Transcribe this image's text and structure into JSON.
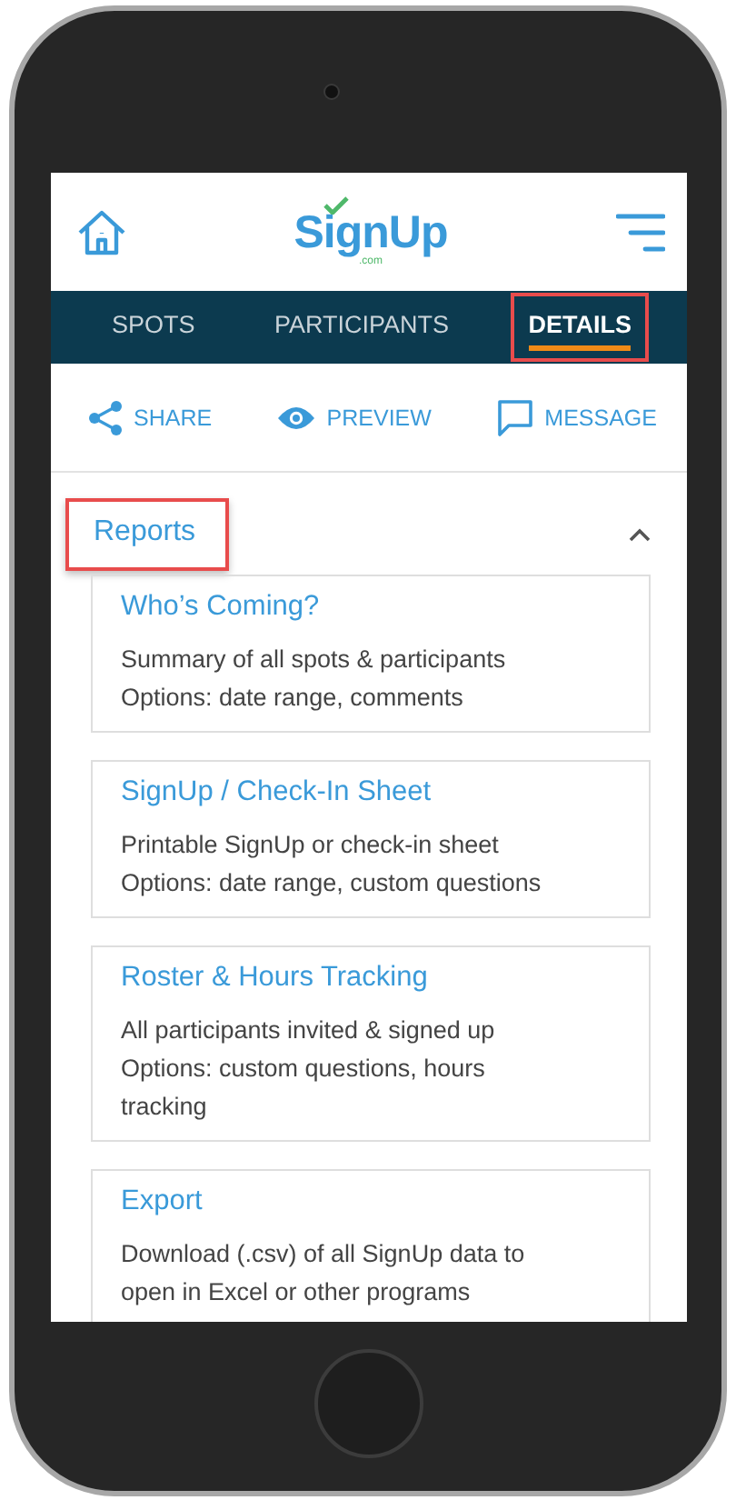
{
  "header": {
    "logo": {
      "text": "SignUp",
      "suffix": ".com"
    }
  },
  "tabs": [
    {
      "label": "SPOTS",
      "selected": false,
      "highlighted": false
    },
    {
      "label": "PARTICIPANTS",
      "selected": false,
      "highlighted": false
    },
    {
      "label": "DETAILS",
      "selected": true,
      "highlighted": true
    }
  ],
  "actions": [
    {
      "kind": "share",
      "label": "SHARE"
    },
    {
      "kind": "preview",
      "label": "PREVIEW"
    },
    {
      "kind": "message",
      "label": "MESSAGE"
    }
  ],
  "section": {
    "title": "Reports",
    "highlighted": true,
    "expanded": true,
    "reports": [
      {
        "title": "Who’s Coming?",
        "lines": [
          "Summary of all spots & participants",
          "Options: date range, comments"
        ]
      },
      {
        "title": "SignUp / Check-In Sheet",
        "lines": [
          "Printable SignUp or check-in sheet",
          "Options: date range, custom questions"
        ]
      },
      {
        "title": "Roster & Hours Tracking",
        "lines": [
          "All participants invited & signed up",
          "Options: custom questions, hours tracking"
        ]
      },
      {
        "title": "Export",
        "lines": [
          "Download (.csv) of all SignUp data to open in Excel or other programs"
        ]
      }
    ]
  }
}
